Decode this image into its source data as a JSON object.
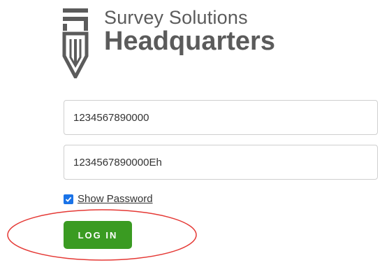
{
  "brand": {
    "line1": "Survey Solutions",
    "line2": "Headquarters",
    "icon": "survey-solutions-logo-icon",
    "color": "#5b5b5b"
  },
  "form": {
    "login_value": "1234567890000",
    "password_value": "1234567890000Eh",
    "show_password_label": "Show Password",
    "show_password_checked": true,
    "login_button_label": "LOG IN"
  },
  "colors": {
    "button": "#3a9b22",
    "checkbox": "#1a73e8",
    "annotation": "#e53935"
  }
}
